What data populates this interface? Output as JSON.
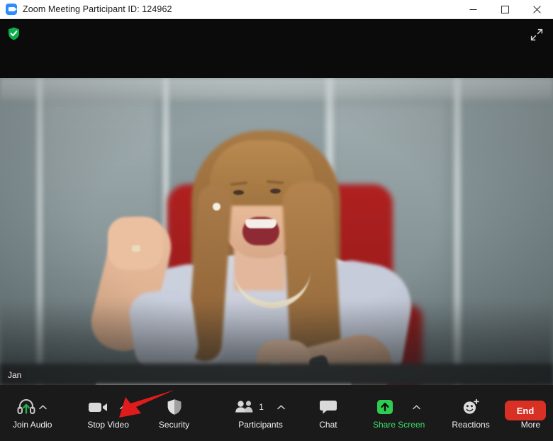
{
  "window": {
    "title": "Zoom Meeting Participant ID: 124962",
    "app_icon": "zoom-camera-icon",
    "controls": {
      "minimize": "minimize-icon",
      "maximize": "maximize-icon",
      "close": "close-icon"
    }
  },
  "stage": {
    "encryption_badge": "green-shield-check-icon",
    "fullscreen": "enter-fullscreen-icon",
    "participant_name": "Jan"
  },
  "annotation": {
    "type": "red-arrow",
    "color": "#e01b1b",
    "points_at": "Stop Video"
  },
  "toolbar": {
    "background": "#1a1a1a",
    "items": [
      {
        "label": "Join Audio",
        "icon": "headset-join-audio-icon",
        "accent": "#3ddc6a",
        "has_chevron": true,
        "label_color": "#f0f0f0"
      },
      {
        "label": "Stop Video",
        "icon": "video-camera-icon",
        "accent": "#e8e8e8",
        "has_chevron": true,
        "label_color": "#f0f0f0"
      },
      {
        "label": "Security",
        "icon": "shield-icon",
        "accent": "#e8e8e8",
        "has_chevron": false,
        "label_color": "#f0f0f0"
      },
      {
        "label": "Participants",
        "icon": "participants-icon",
        "accent": "#e8e8e8",
        "has_chevron": true,
        "badge": "1",
        "label_color": "#f0f0f0"
      },
      {
        "label": "Chat",
        "icon": "chat-bubble-icon",
        "accent": "#e8e8e8",
        "has_chevron": false,
        "label_color": "#f0f0f0"
      },
      {
        "label": "Share Screen",
        "icon": "share-screen-up-arrow-icon",
        "accent": "#2ecc4f",
        "has_chevron": true,
        "label_color": "#3ddc6a"
      },
      {
        "label": "Reactions",
        "icon": "smiley-reactions-icon",
        "accent": "#e8e8e8",
        "has_chevron": false,
        "label_color": "#f0f0f0"
      },
      {
        "label": "More",
        "icon": "ellipsis-more-icon",
        "accent": "#e8e8e8",
        "has_chevron": false,
        "label_color": "#f0f0f0"
      }
    ],
    "end_button": {
      "label": "End",
      "color": "#d93025"
    }
  }
}
